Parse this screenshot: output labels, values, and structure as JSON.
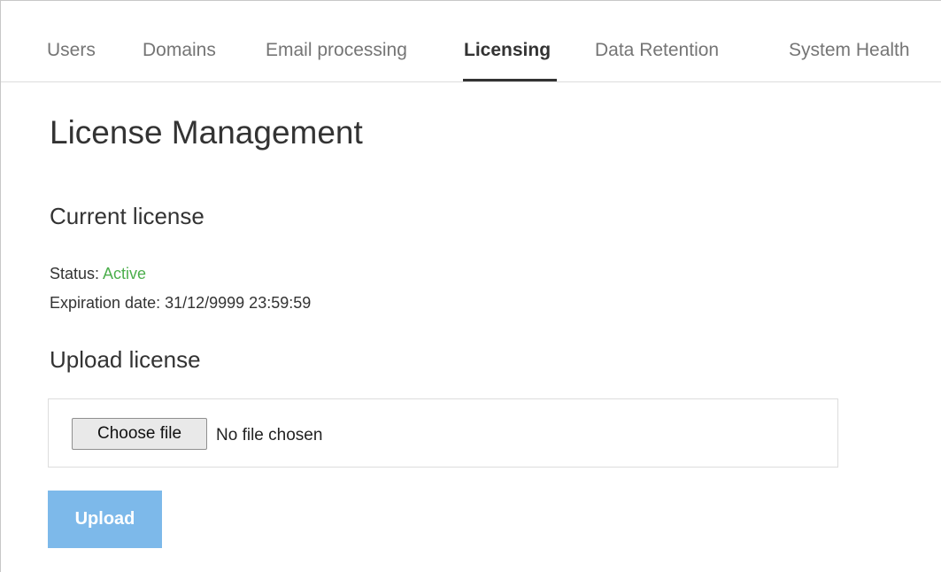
{
  "tabs": [
    {
      "label": "Users"
    },
    {
      "label": "Domains"
    },
    {
      "label": "Email processing"
    },
    {
      "label": "Licensing",
      "active": true
    },
    {
      "label": "Data Retention"
    },
    {
      "label": "System Health"
    }
  ],
  "page": {
    "title": "License Management"
  },
  "current_license": {
    "heading": "Current license",
    "status_label": "Status:",
    "status_value": "Active",
    "expiration_label": "Expiration date:",
    "expiration_value": "31/12/9999 23:59:59"
  },
  "upload": {
    "heading": "Upload license",
    "choose_file_label": "Choose file",
    "file_status": "No file chosen",
    "upload_label": "Upload"
  },
  "colors": {
    "accent_active_status": "#4cae4c",
    "upload_button": "#7db9ea",
    "active_tab_underline": "#333333"
  }
}
